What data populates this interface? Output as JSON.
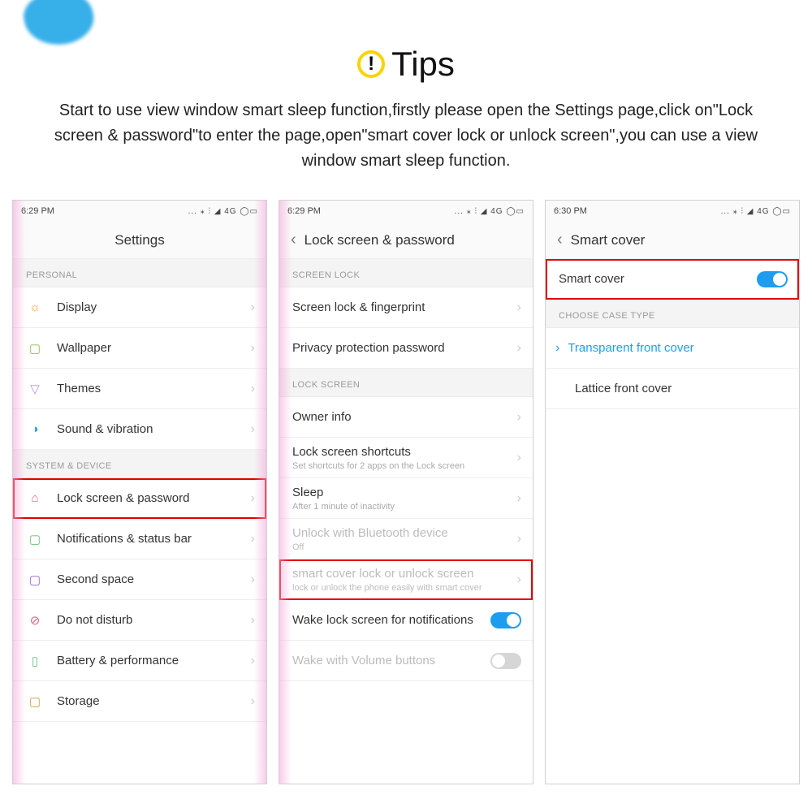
{
  "header": {
    "title": "Tips",
    "body": "Start to use view window smart sleep function,firstly please open the Settings page,click on\"Lock screen & password\"to enter the page,open\"smart cover lock or unlock screen\",you can use a view window smart sleep function."
  },
  "status_icons": "...  ⁎  ⫶  ◢  4G  ◯▭",
  "screen1": {
    "time": "6:29 PM",
    "title": "Settings",
    "sec_personal": "PERSONAL",
    "sec_system": "SYSTEM & DEVICE",
    "items": {
      "display": "Display",
      "wallpaper": "Wallpaper",
      "themes": "Themes",
      "sound": "Sound & vibration",
      "lock": "Lock screen & password",
      "notif": "Notifications & status bar",
      "space": "Second space",
      "dnd": "Do not disturb",
      "batt": "Battery & performance",
      "storage": "Storage"
    }
  },
  "screen2": {
    "time": "6:29 PM",
    "title": "Lock screen & password",
    "sec_screenlock": "SCREEN LOCK",
    "sec_lockscreen": "LOCK SCREEN",
    "items": {
      "fp": "Screen lock & fingerprint",
      "priv": "Privacy protection password",
      "owner": "Owner info",
      "shortcuts": "Lock screen shortcuts",
      "shortcuts_sub": "Set shortcuts for 2 apps on the Lock screen",
      "sleep": "Sleep",
      "sleep_sub": "After 1 minute of inactivity",
      "bt": "Unlock with Bluetooth device",
      "bt_sub": "Off",
      "smart": "smart cover lock or unlock screen",
      "smart_sub": "lock or unlock the phone easily with smart cover",
      "wake_notif": "Wake lock screen for notifications",
      "wake_vol": "Wake with Volume buttons"
    }
  },
  "screen3": {
    "time": "6:30 PM",
    "title": "Smart cover",
    "items": {
      "smart_toggle": "Smart cover",
      "sec_choose": "CHOOSE CASE TYPE",
      "transparent": "Transparent front cover",
      "lattice": "Lattice front cover"
    }
  }
}
